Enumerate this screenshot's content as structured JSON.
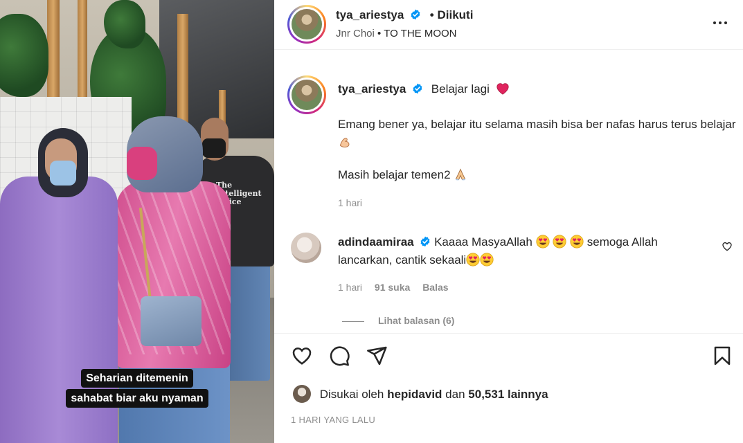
{
  "media": {
    "caption_line1": "Seharian ditemenin",
    "caption_line2": "sahabat biar aku nyaman",
    "tshirt_text": "The Intelligent Office"
  },
  "header": {
    "username": "tya_ariestya",
    "follow_status": "Diikuti",
    "separator": "•",
    "music_artist": "Jnr Choi",
    "music_title": "TO THE MOON"
  },
  "post": {
    "username": "tya_ariestya",
    "caption_title": "Belajar lagi",
    "paragraph1": "Emang bener ya, belajar itu selama masih bisa ber nafas harus terus belajar",
    "paragraph2": "Masih belajar temen2",
    "time": "1 hari"
  },
  "comment": {
    "username": "adindaamiraa",
    "text_part1": "Kaaaa MasyaAllah",
    "text_part2": "semoga Allah lancarkan, cantik sekaali",
    "time": "1 hari",
    "likes": "91 suka",
    "reply_label": "Balas",
    "view_replies": "Lihat balasan (6)"
  },
  "actions": {
    "liked_by_prefix": "Disukai oleh",
    "liked_by_user": "hepidavid",
    "liked_by_and": "dan",
    "liked_by_count": "50,531 lainnya",
    "date": "1 HARI YANG LALU"
  },
  "colors": {
    "verified_blue": "#0095f6",
    "text_primary": "#262626",
    "text_secondary": "#8e8e8e",
    "caption_bg": "#111111"
  },
  "icons": {
    "more": "more-icon",
    "like": "heart-outline-icon",
    "comment": "comment-bubble-icon",
    "share": "paper-plane-icon",
    "save": "bookmark-icon",
    "verified": "verified-badge-icon"
  }
}
